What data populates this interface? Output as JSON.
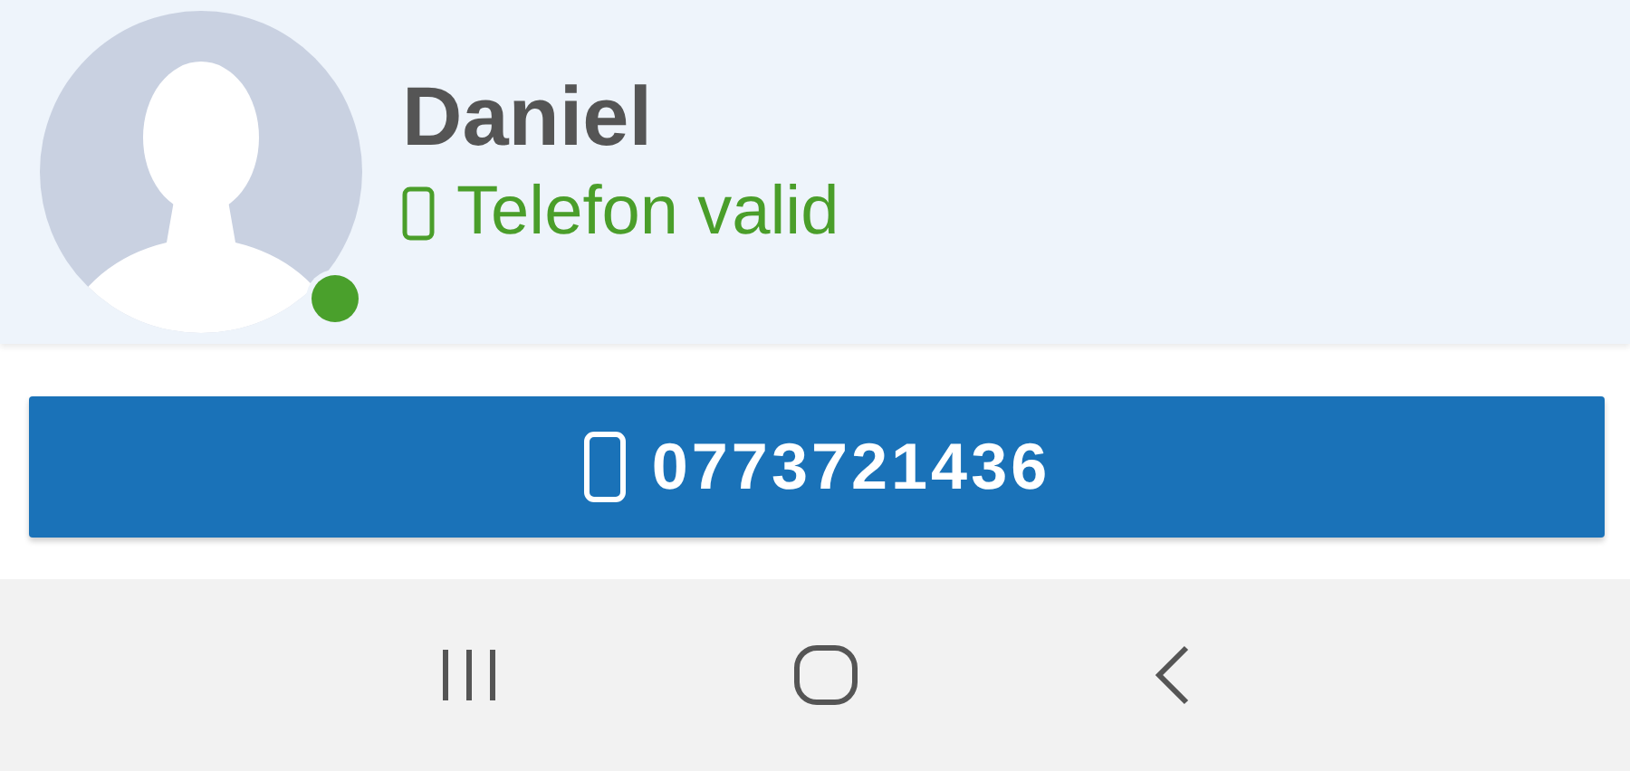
{
  "contact": {
    "name": "Daniel",
    "online": true,
    "status": {
      "text": "Telefon valid",
      "valid": true
    }
  },
  "call_button": {
    "number": "0773721436"
  }
}
